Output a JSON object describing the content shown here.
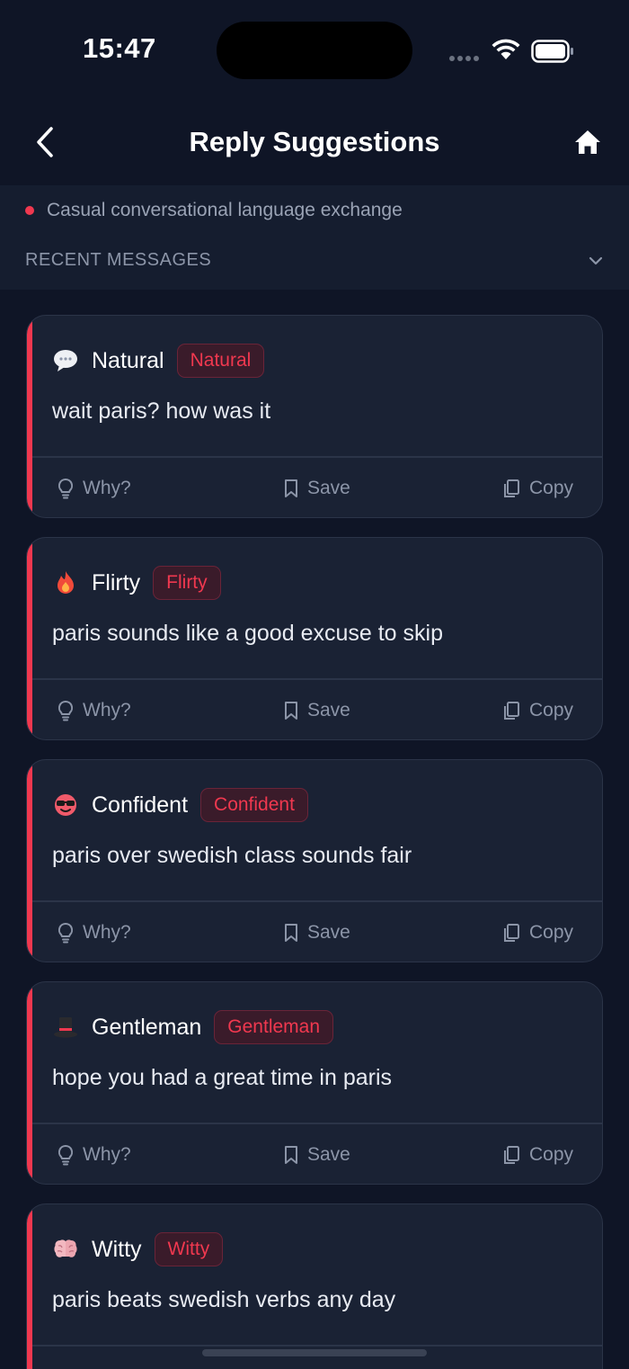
{
  "status_bar": {
    "time": "15:47"
  },
  "header": {
    "title": "Reply Suggestions",
    "back_icon": "chevron-left-icon",
    "home_icon": "home-icon"
  },
  "context": {
    "description": "Casual conversational language exchange",
    "recent_label": "RECENT MESSAGES",
    "dot_color": "#f0384f"
  },
  "actions": {
    "why": "Why?",
    "save": "Save",
    "copy": "Copy"
  },
  "suggestions": [
    {
      "style": "Natural",
      "badge": "Natural",
      "emoji": "speech-bubble-icon",
      "text": "wait paris? how was it"
    },
    {
      "style": "Flirty",
      "badge": "Flirty",
      "emoji": "fire-icon",
      "text": "paris sounds like a good excuse to skip"
    },
    {
      "style": "Confident",
      "badge": "Confident",
      "emoji": "sunglasses-face-icon",
      "text": "paris over swedish class sounds fair"
    },
    {
      "style": "Gentleman",
      "badge": "Gentleman",
      "emoji": "top-hat-icon",
      "text": "hope you had a great time in paris"
    },
    {
      "style": "Witty",
      "badge": "Witty",
      "emoji": "brain-icon",
      "text": "paris beats swedish verbs any day"
    }
  ],
  "colors": {
    "accent": "#f0384f",
    "background": "#0f1526",
    "card": "#1a2234"
  }
}
